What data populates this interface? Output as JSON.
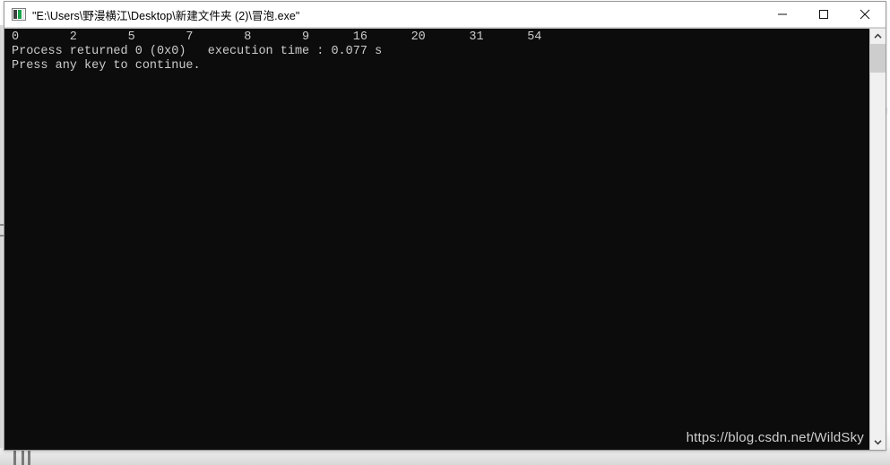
{
  "window": {
    "title": "\"E:\\Users\\野漫横江\\Desktop\\新建文件夹 (2)\\冒泡.exe\"",
    "icon": "console-app-icon",
    "controls": {
      "minimize": "minimize-button",
      "maximize": "maximize-button",
      "close": "close-button"
    }
  },
  "console": {
    "background_color": "#0c0c0c",
    "text_color": "#cccccc",
    "lines": [
      "0       2       5       7       8       9      16      20      31      54",
      "Process returned 0 (0x0)   execution time : 0.077 s",
      "Press any key to continue."
    ],
    "sorted_numbers": [
      0,
      2,
      5,
      7,
      8,
      9,
      16,
      20,
      31,
      54
    ],
    "exit_code": "0 (0x0)",
    "execution_time": "0.077 s",
    "prompt": "Press any key to continue."
  },
  "watermark": {
    "text": "https://blog.csdn.net/WildSky"
  },
  "scrollbar": {
    "up_arrow": "scroll-up-arrow",
    "down_arrow": "scroll-down-arrow"
  }
}
